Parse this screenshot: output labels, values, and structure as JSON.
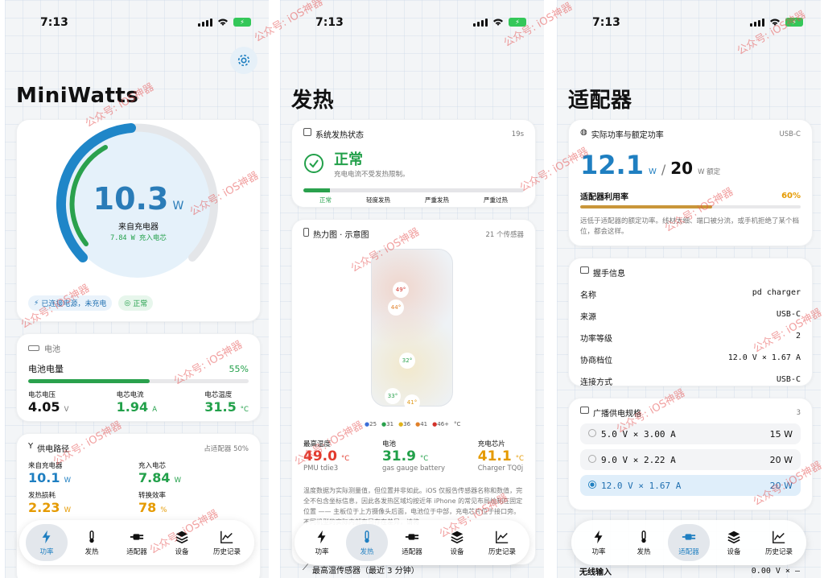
{
  "status": {
    "time": "7:13"
  },
  "watermark": "公众号: iOS神器",
  "tabs": [
    {
      "label": "功率",
      "icon": "bolt-icon"
    },
    {
      "label": "发热",
      "icon": "thermometer-icon"
    },
    {
      "label": "适配器",
      "icon": "plug-icon"
    },
    {
      "label": "设备",
      "icon": "stack-icon"
    },
    {
      "label": "历史记录",
      "icon": "chart-line-icon"
    }
  ],
  "p1": {
    "title": "MiniWatts",
    "gauge": {
      "value": "10.3",
      "unit": "W",
      "source": "来自充电器",
      "sub": "7.84 W 充入电芯",
      "level": 0.52
    },
    "pills": [
      "已连接电源，未充电",
      "正常"
    ],
    "battery": {
      "header": "电池",
      "level_label": "电池电量",
      "level_value": "55%",
      "level": 0.55,
      "stats": [
        {
          "label": "电芯电压",
          "value": "4.05",
          "unit": "V"
        },
        {
          "label": "电芯电流",
          "value": "1.94",
          "unit": "A"
        },
        {
          "label": "电芯温度",
          "value": "31.5",
          "unit": "°C"
        }
      ]
    },
    "path": {
      "header": "供电路径",
      "right": "占适配器 50%",
      "stats": [
        {
          "label": "来自充电器",
          "value": "10.1",
          "unit": "W"
        },
        {
          "label": "充入电芯",
          "value": "7.84",
          "unit": "W"
        },
        {
          "label": "发热损耗",
          "value": "2.23",
          "unit": "W"
        },
        {
          "label": "转换效率",
          "value": "78",
          "unit": "%"
        }
      ]
    }
  },
  "p2": {
    "title": "发热",
    "state": {
      "header": "系统发热状态",
      "age": "19s",
      "value": "正常",
      "desc": "充电电流不受发热限制。",
      "scale": [
        "正常",
        "轻度发热",
        "严重发热",
        "严重过热"
      ]
    },
    "heatmap": {
      "header": "热力图 · 示意图",
      "count": "21 个传感器",
      "markers": [
        "49°",
        "44°",
        "32°",
        "33°",
        "41°"
      ],
      "legend": [
        "25",
        "31",
        "36",
        "41",
        "46+",
        "°C"
      ],
      "stats": [
        {
          "label": "最高温度",
          "value": "49.0",
          "unit": "°C",
          "sub": "PMU tdie3"
        },
        {
          "label": "电池",
          "value": "31.9",
          "unit": "°C",
          "sub": "gas gauge battery"
        },
        {
          "label": "充电芯片",
          "value": "41.1",
          "unit": "°C",
          "sub": "Charger TQ0j"
        }
      ],
      "note": "温度数据为实际测量值，但位置并非如此。iOS 仅报告传感器名称和数值，完全不包含坐标信息，因此各发热区域均按近年 iPhone 的常见布局绘制在固定位置 —— 主板位于上方摄像头后面，电池位于中部，充电芯片位于接口旁。不同机型的实际内部布局存在差异，请将"
    },
    "bottom_header": "最高温传感器（最近 3 分钟）"
  },
  "p3": {
    "title": "适配器",
    "power": {
      "header": "实际功率与额定功率",
      "port": "USB-C",
      "actual": "12.1",
      "actual_unit": "W",
      "sep": "/",
      "rated": "20",
      "rated_unit": "W 额定",
      "util_label": "适配器利用率",
      "util_value": "60%",
      "util": 0.6,
      "desc": "远低于适配器的额定功率。线材太细、端口被分流，或手机拒绝了某个档位，都会这样。"
    },
    "handshake": {
      "header": "握手信息",
      "rows": [
        {
          "k": "名称",
          "v": "pd charger"
        },
        {
          "k": "来源",
          "v": "USB-C"
        },
        {
          "k": "功率等级",
          "v": "2"
        },
        {
          "k": "协商档位",
          "v": "12.0 V × 1.67 A"
        },
        {
          "k": "连接方式",
          "v": "USB-C"
        }
      ]
    },
    "pdo": {
      "header": "广播供电规格",
      "count": "3",
      "options": [
        {
          "v": "5.0 V × 3.00 A",
          "w": "15 W"
        },
        {
          "v": "9.0 V × 2.22 A",
          "w": "20 W"
        },
        {
          "v": "12.0 V × 1.67 A",
          "w": "20 W"
        }
      ]
    },
    "bottom": {
      "k": "无线输入",
      "v": "0.00 V × —"
    }
  }
}
